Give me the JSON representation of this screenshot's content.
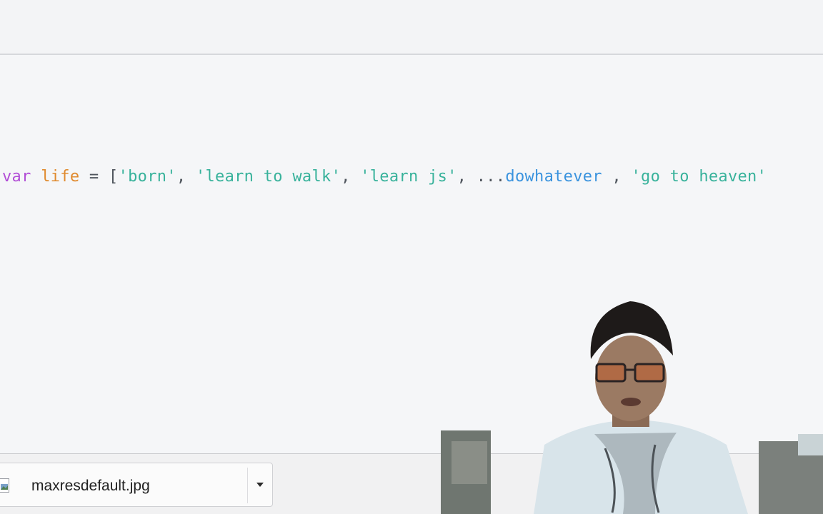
{
  "editor": {
    "code_tokens": {
      "keyword": "var",
      "identifier": "life",
      "assign": "=",
      "open_bracket": "[",
      "str1": "'born'",
      "comma1": ",",
      "str2": "'learn to walk'",
      "comma2": ",",
      "str3": "'learn js'",
      "comma3": ",",
      "spread_dots": "...",
      "spread_name": "dowhatever",
      "comma4": ",",
      "str4": "'go to heaven'"
    }
  },
  "download_bar": {
    "item": {
      "file_name": "maxresdefault.jpg",
      "icon": "image-file-icon",
      "menu_icon": "caret-down-icon"
    }
  },
  "overlay": {
    "webcam": "presenter-webcam"
  },
  "colors": {
    "keyword": "#b24fd6",
    "identifier": "#e08a2e",
    "string": "#38b29b",
    "spread": "#3a93de",
    "background": "#f5f6f8"
  }
}
